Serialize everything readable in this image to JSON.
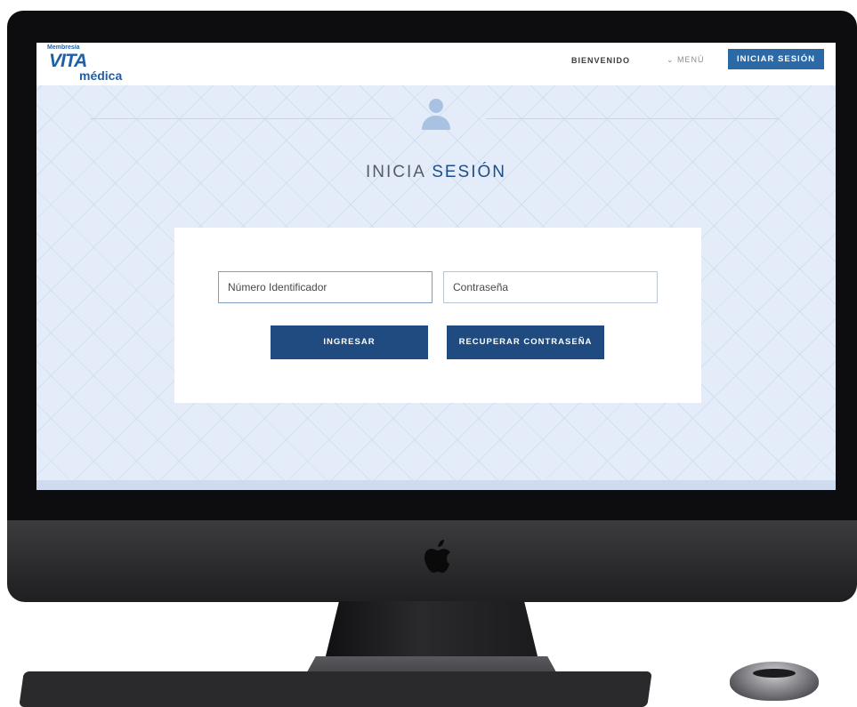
{
  "brand": {
    "top": "Membresía",
    "name": "VITA",
    "sub": "médica"
  },
  "navbar": {
    "welcome": "BIENVENIDO",
    "menu": "⌄ MENÚ",
    "login": "INICIAR SESIÓN"
  },
  "page": {
    "title_part1": "INICIA",
    "title_part2": "SESIÓN"
  },
  "form": {
    "id_placeholder": "Número Identificador",
    "password_placeholder": "Contraseña",
    "submit_label": "INGRESAR",
    "recover_label": "RECUPERAR CONTRASEÑA"
  },
  "colors": {
    "primary": "#1f4b80",
    "nav_button": "#2b6aa6",
    "screen_bg": "#e3ecf8",
    "accent_text": "#1f4e86"
  },
  "icons": {
    "user": "user-avatar-icon",
    "apple": "apple-logo-icon",
    "menu_chevron": "chevron-down-icon"
  }
}
